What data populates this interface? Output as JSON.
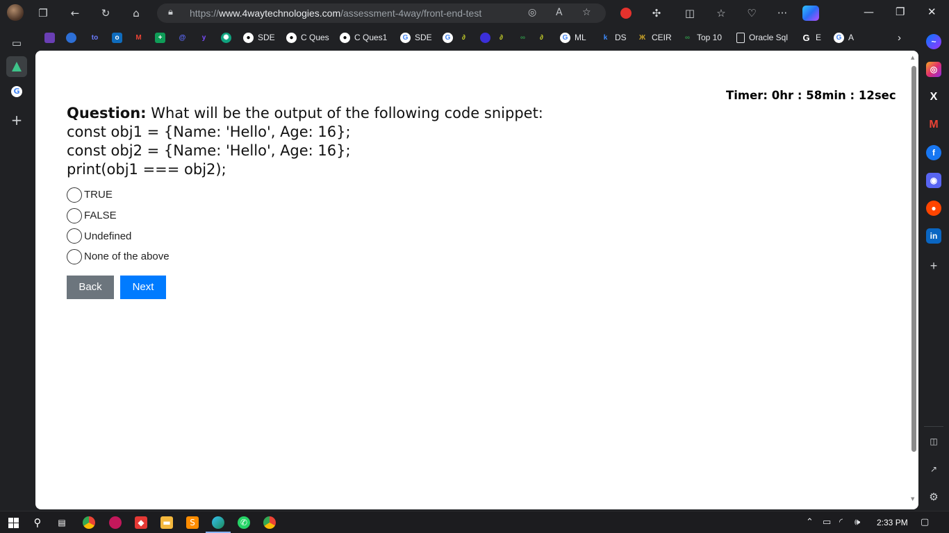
{
  "browser": {
    "url_prefix": "https://",
    "url_domain": "www.4waytechnologies.com",
    "url_path": "/assessment-4way/front-end-test",
    "more_label": "···",
    "window": {
      "minimize": "—",
      "restore": "❐",
      "close": "✕"
    }
  },
  "favorites": [
    {
      "label": "SDE",
      "icon": "github-icon"
    },
    {
      "label": "C Ques",
      "icon": "github-icon"
    },
    {
      "label": "C Ques1",
      "icon": "github-icon"
    },
    {
      "label": "SDE",
      "icon": "google-icon"
    },
    {
      "label": "ML",
      "icon": "google-icon"
    },
    {
      "label": "DS",
      "icon": "k-icon"
    },
    {
      "label": "CEIR",
      "icon": "ceir-icon"
    },
    {
      "label": "Top 10",
      "icon": "gfg-icon"
    },
    {
      "label": "Oracle Sql",
      "icon": "page-icon"
    },
    {
      "label": "E",
      "icon": "google-icon"
    },
    {
      "label": "A",
      "icon": "google-icon"
    }
  ],
  "page": {
    "timer": "Timer: 0hr : 58min : 12sec",
    "question_label": "Question:",
    "question_text": " What will be the output of the following code snippet:",
    "code_lines": [
      "const obj1 = {Name: 'Hello', Age: 16};",
      "const obj2 = {Name: 'Hello', Age: 16};",
      "print(obj1 === obj2);"
    ],
    "options": [
      "TRUE",
      "FALSE",
      "Undefined",
      "None of the above"
    ],
    "back_label": "Back",
    "next_label": "Next"
  },
  "taskbar": {
    "clock": "2:33 PM"
  },
  "colors": {
    "back_button": "#6c757d",
    "next_button": "#007bff",
    "chrome_bg": "#202124"
  }
}
